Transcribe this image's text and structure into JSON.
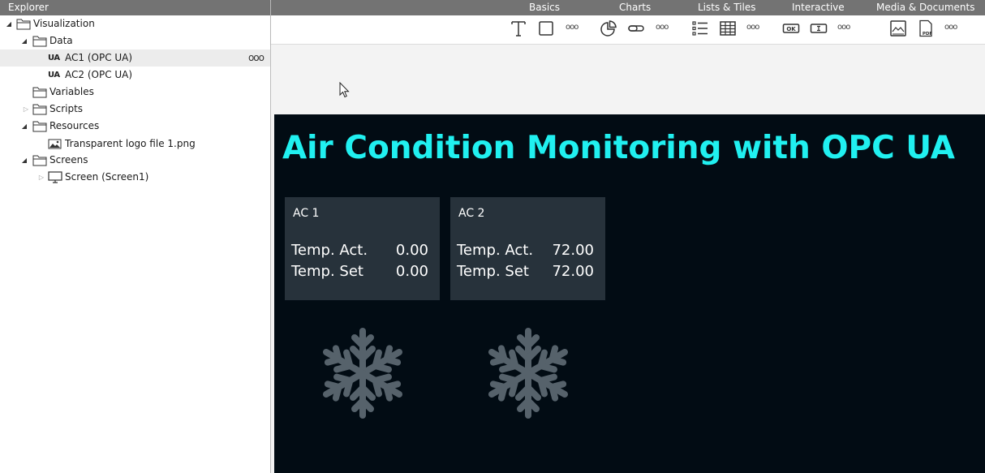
{
  "explorer": {
    "title": "Explorer",
    "tree": [
      {
        "label": "Visualization",
        "icon": "folder-icon",
        "expanded": true
      },
      {
        "label": "Data",
        "icon": "folder-icon",
        "expanded": true
      },
      {
        "label": "AC1 (OPC UA)",
        "icon": "opc-ua-icon",
        "selected": true,
        "more": "ooo"
      },
      {
        "label": "AC2 (OPC UA)",
        "icon": "opc-ua-icon"
      },
      {
        "label": "Variables",
        "icon": "folder-icon"
      },
      {
        "label": "Scripts",
        "icon": "folder-icon",
        "expanded": false
      },
      {
        "label": "Resources",
        "icon": "folder-icon",
        "expanded": true
      },
      {
        "label": "Transparent logo file 1.png",
        "icon": "image-icon"
      },
      {
        "label": "Screens",
        "icon": "folder-icon",
        "expanded": true
      },
      {
        "label": "Screen (Screen1)",
        "icon": "monitor-icon",
        "expanded": false
      }
    ],
    "ua_badge": "UA"
  },
  "toolbar": {
    "tabs": [
      "Basics",
      "Charts",
      "Lists & Tiles",
      "Interactive",
      "Media & Documents"
    ],
    "more_label": "ooo",
    "tools": {
      "basics": [
        "text-tool-icon",
        "rectangle-tool-icon"
      ],
      "charts": [
        "pie-chart-tool-icon",
        "progress-bar-tool-icon"
      ],
      "lists": [
        "list-tool-icon",
        "table-tool-icon"
      ],
      "interactive": [
        "button-tool-icon",
        "input-field-tool-icon"
      ],
      "media": [
        "image-tool-icon",
        "pdf-tool-icon"
      ]
    },
    "button_tool_text": "OK",
    "pdf_tool_text": "PDF"
  },
  "screen": {
    "title": "Air Condition Monitoring with OPC UA",
    "background": "#020c14",
    "title_color": "#20f0f0",
    "cards": [
      {
        "title": "AC 1",
        "act_label": "Temp. Act.",
        "act_value": "0.00",
        "set_label": "Temp. Set",
        "set_value": "0.00"
      },
      {
        "title": "AC 2",
        "act_label": "Temp. Act.",
        "act_value": "72.00",
        "set_label": "Temp. Set",
        "set_value": "72.00"
      }
    ],
    "card_color": "#27323b",
    "icon": "snowflake-icon",
    "icon_color": "#56626b"
  }
}
